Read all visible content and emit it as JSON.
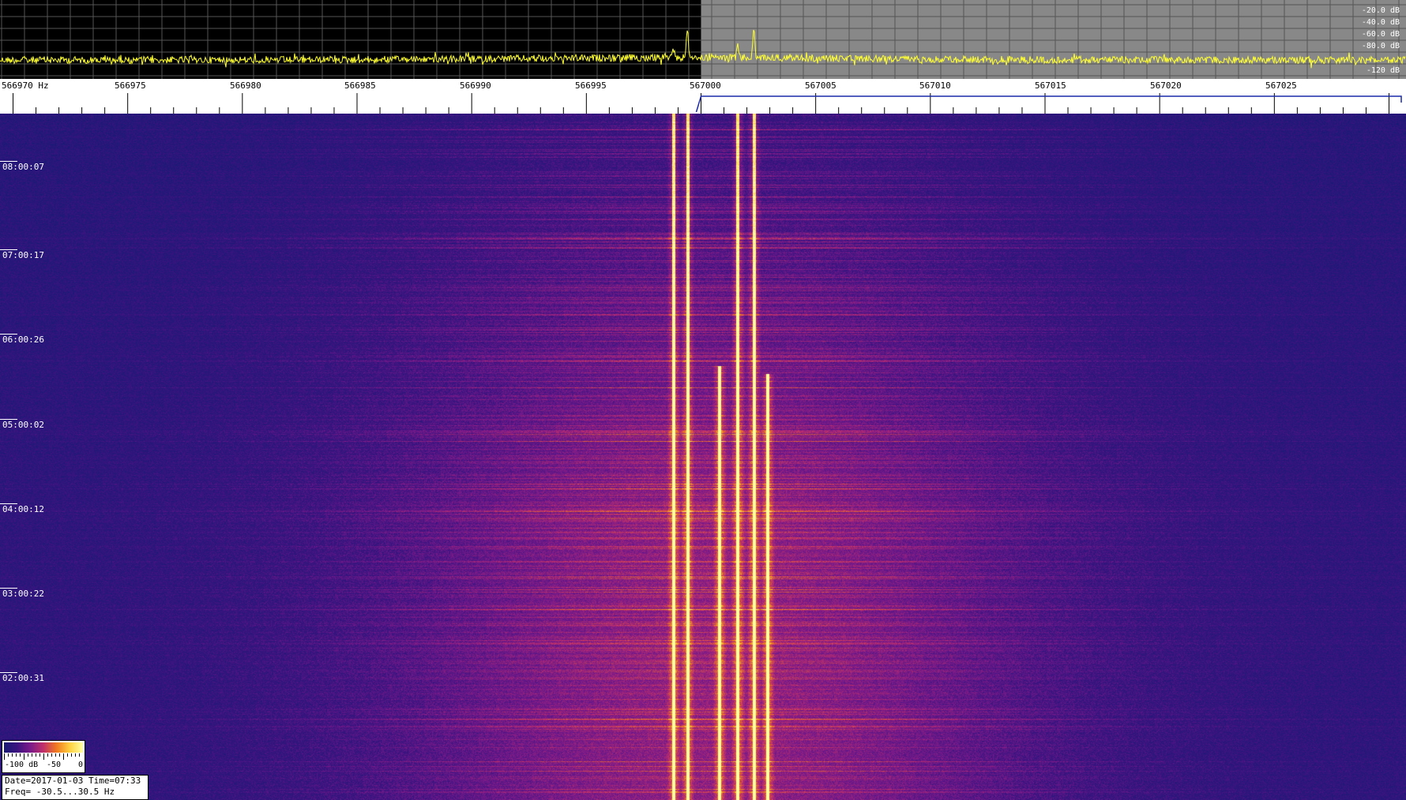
{
  "spectrum": {
    "db_scale": [
      "-20.0 dB",
      "-40.0 dB",
      "-60.0 dB",
      "-80.0 dB"
    ],
    "db_bottom": "-120 dB",
    "colors": {
      "background": "#000000",
      "trace": "#ffff33",
      "grid": "#555555",
      "selected_band": "#888888"
    }
  },
  "frequency_axis": {
    "labels": [
      {
        "value": 566970,
        "text": "566970 Hz"
      },
      {
        "value": 566975,
        "text": "566975"
      },
      {
        "value": 566980,
        "text": "566980"
      },
      {
        "value": 566985,
        "text": "566985"
      },
      {
        "value": 566990,
        "text": "566990"
      },
      {
        "value": 566995,
        "text": "566995"
      },
      {
        "value": 567000,
        "text": "567000"
      },
      {
        "value": 567005,
        "text": "567005"
      },
      {
        "value": 567010,
        "text": "567010"
      },
      {
        "value": 567015,
        "text": "567015"
      },
      {
        "value": 567020,
        "text": "567020"
      },
      {
        "value": 567025,
        "text": "567025"
      }
    ],
    "range_hz": [
      566969.5,
      567030.5
    ],
    "selection_hz": [
      567000,
      567030.5
    ]
  },
  "waterfall": {
    "time_labels": [
      "08:00:07",
      "07:00:17",
      "06:00:26",
      "05:00:02",
      "04:00:12",
      "03:00:22",
      "02:00:31"
    ],
    "carriers_hz": [
      566998.8,
      567000.8,
      567001.6,
      567002.3,
      567002.9,
      566999.4
    ],
    "palette": [
      "#1a1a75",
      "#3a1480",
      "#7a1a8a",
      "#c0306a",
      "#f07a20",
      "#ffd040",
      "#ffffa0"
    ]
  },
  "colorbar": {
    "labels": [
      "-100 dB",
      "-50",
      "0"
    ]
  },
  "info": {
    "date_time": "Date=2017-01-03 Time=07:33",
    "freq": "Freq= -30.5...30.5 Hz"
  }
}
